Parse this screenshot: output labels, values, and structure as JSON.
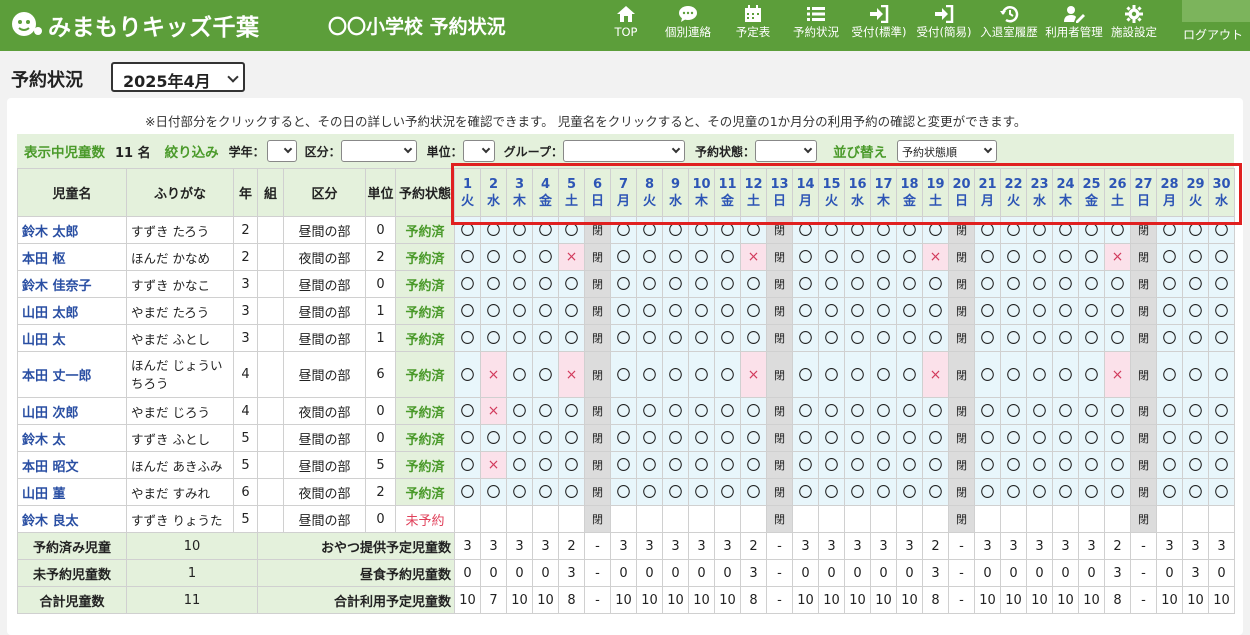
{
  "header": {
    "brand": "みまもりキッズ千葉",
    "school_title": "〇〇小学校 予約状況",
    "nav": [
      {
        "label": "TOP",
        "icon": "home-icon"
      },
      {
        "label": "個別連絡",
        "icon": "chat-bubble-icon"
      },
      {
        "label": "予定表",
        "icon": "calendar-icon"
      },
      {
        "label": "予約状況",
        "icon": "list-icon"
      },
      {
        "label": "受付(標準)",
        "icon": "sign-in-icon"
      },
      {
        "label": "受付(簡易)",
        "icon": "sign-in-icon"
      },
      {
        "label": "入退室履歴",
        "icon": "history-icon"
      },
      {
        "label": "利用者管理",
        "icon": "user-edit-icon"
      },
      {
        "label": "施設設定",
        "icon": "gear-icon"
      }
    ],
    "logout": "ログアウト"
  },
  "page": {
    "title": "予約状況",
    "month": "2025年4月"
  },
  "notice": "※日付部分をクリックすると、その日の詳しい予約状況を確認できます。 児童名をクリックすると、その児童の1か月分の利用予約の確認と変更ができます。",
  "filters": {
    "count_label": "表示中児童数",
    "count_value": "11 名",
    "filter_label": "絞り込み",
    "grade": "学年：",
    "division": "区分：",
    "unit": "単位：",
    "group": "グループ：",
    "status": "予約状態：",
    "sort_label": "並び替え",
    "sort_value": "予約状態順"
  },
  "table": {
    "headers": {
      "name": "児童名",
      "kana": "ふりがな",
      "grade": "年",
      "class": "組",
      "division": "区分",
      "unit": "単位",
      "status": "予約状態"
    },
    "days": [
      {
        "d": "1",
        "w": "火"
      },
      {
        "d": "2",
        "w": "水"
      },
      {
        "d": "3",
        "w": "木"
      },
      {
        "d": "4",
        "w": "金"
      },
      {
        "d": "5",
        "w": "土"
      },
      {
        "d": "6",
        "w": "日"
      },
      {
        "d": "7",
        "w": "月"
      },
      {
        "d": "8",
        "w": "火"
      },
      {
        "d": "9",
        "w": "水"
      },
      {
        "d": "10",
        "w": "木"
      },
      {
        "d": "11",
        "w": "金"
      },
      {
        "d": "12",
        "w": "土"
      },
      {
        "d": "13",
        "w": "日"
      },
      {
        "d": "14",
        "w": "月"
      },
      {
        "d": "15",
        "w": "火"
      },
      {
        "d": "16",
        "w": "水"
      },
      {
        "d": "17",
        "w": "木"
      },
      {
        "d": "18",
        "w": "金"
      },
      {
        "d": "19",
        "w": "土"
      },
      {
        "d": "20",
        "w": "日"
      },
      {
        "d": "21",
        "w": "月"
      },
      {
        "d": "22",
        "w": "火"
      },
      {
        "d": "23",
        "w": "水"
      },
      {
        "d": "24",
        "w": "木"
      },
      {
        "d": "25",
        "w": "金"
      },
      {
        "d": "26",
        "w": "土"
      },
      {
        "d": "27",
        "w": "日"
      },
      {
        "d": "28",
        "w": "月"
      },
      {
        "d": "29",
        "w": "火"
      },
      {
        "d": "30",
        "w": "水"
      }
    ],
    "symbols": {
      "o": "〇",
      "x": "×",
      "c": "閉"
    },
    "rows": [
      {
        "name": "鈴木 太郎",
        "kana": "すずき たろう",
        "grade": "2",
        "class": "",
        "division": "昼間の部",
        "unit": "0",
        "status": "予約済",
        "marks": "ooooocoooooocooooooc"
      },
      {
        "name": "本田 枢",
        "kana": "ほんだ かなめ",
        "grade": "2",
        "class": "",
        "division": "夜間の部",
        "unit": "2",
        "status": "予約済",
        "marks": ""
      },
      {
        "name": "鈴木 佳奈子",
        "kana": "すずき かなこ",
        "grade": "3",
        "class": "",
        "division": "昼間の部",
        "unit": "0",
        "status": "予約済",
        "marks": ""
      },
      {
        "name": "山田 太郎",
        "kana": "やまだ たろう",
        "grade": "3",
        "class": "",
        "division": "昼間の部",
        "unit": "1",
        "status": "予約済",
        "marks": ""
      },
      {
        "name": "山田 太",
        "kana": "やまだ ふとし",
        "grade": "3",
        "class": "",
        "division": "昼間の部",
        "unit": "1",
        "status": "予約済",
        "marks": ""
      },
      {
        "name": "本田 丈一郎",
        "kana": "ほんだ じょういちろう",
        "grade": "4",
        "class": "",
        "division": "昼間の部",
        "unit": "6",
        "status": "予約済",
        "marks": ""
      },
      {
        "name": "山田 次郎",
        "kana": "やまだ じろう",
        "grade": "4",
        "class": "",
        "division": "夜間の部",
        "unit": "0",
        "status": "予約済",
        "marks": ""
      },
      {
        "name": "鈴木 太",
        "kana": "すずき ふとし",
        "grade": "5",
        "class": "",
        "division": "昼間の部",
        "unit": "0",
        "status": "予約済",
        "marks": ""
      },
      {
        "name": "本田 昭文",
        "kana": "ほんだ あきふみ",
        "grade": "5",
        "class": "",
        "division": "昼間の部",
        "unit": "5",
        "status": "予約済",
        "marks": ""
      },
      {
        "name": "山田 菫",
        "kana": "やまだ すみれ",
        "grade": "6",
        "class": "",
        "division": "夜間の部",
        "unit": "2",
        "status": "予約済",
        "marks": ""
      },
      {
        "name": "鈴木 良太",
        "kana": "すずき りょうた",
        "grade": "5",
        "class": "",
        "division": "昼間の部",
        "unit": "0",
        "status": "未予約",
        "marks": ""
      }
    ],
    "grid": [
      "ooooocoooooocooooooocoooooocooo",
      "oooox coooooxcooooooxcoooooxcooo",
      "ooooocoooooocooooooocoooooocooo",
      "ooooocoooooocooooooocoooooocooo",
      "ooooocoooooocooooooocoooooocooo",
      "oxooxcooooo xcoooooxcoooooxcooo",
      "oxoooco ooooocooooooocoooooocooo",
      "ooooocoooooocooooooocoooooocooo",
      "oxoooco ooooocooooooocoooooocooo",
      "ooooocoooooocooooooocoooooocooo",
      "-----c------c------c------c---"
    ],
    "summary": [
      {
        "left_label": "予約済み児童",
        "left_value": "10",
        "right_label": "おやつ提供予定児童数",
        "values": [
          "3",
          "3",
          "3",
          "3",
          "2",
          "-",
          "3",
          "3",
          "3",
          "3",
          "3",
          "2",
          "-",
          "3",
          "3",
          "3",
          "3",
          "3",
          "2",
          "-",
          "3",
          "3",
          "3",
          "3",
          "3",
          "2",
          "-",
          "3",
          "3",
          "3"
        ]
      },
      {
        "left_label": "未予約児童数",
        "left_value": "1",
        "right_label": "昼食予約児童数",
        "values": [
          "0",
          "0",
          "0",
          "0",
          "3",
          "-",
          "0",
          "0",
          "0",
          "0",
          "0",
          "3",
          "-",
          "0",
          "0",
          "0",
          "0",
          "0",
          "3",
          "-",
          "0",
          "0",
          "0",
          "0",
          "0",
          "3",
          "-",
          "0",
          "3",
          "0"
        ]
      },
      {
        "left_label": "合計児童数",
        "left_value": "11",
        "right_label": "合計利用予定児童数",
        "values": [
          "10",
          "7",
          "10",
          "10",
          "8",
          "-",
          "10",
          "10",
          "10",
          "10",
          "10",
          "8",
          "-",
          "10",
          "10",
          "10",
          "10",
          "10",
          "8",
          "-",
          "10",
          "10",
          "10",
          "10",
          "10",
          "8",
          "-",
          "10",
          "10",
          "10"
        ]
      }
    ]
  }
}
